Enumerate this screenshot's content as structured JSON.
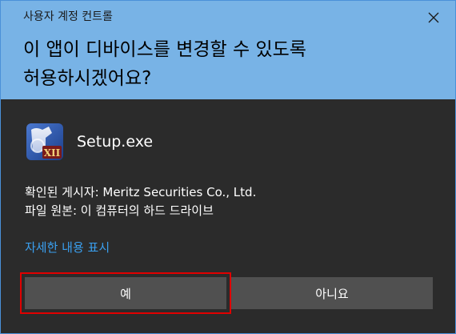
{
  "window": {
    "title": "사용자 계정 컨트롤",
    "close_icon": "close-icon"
  },
  "prompt": {
    "question": "이 앱이 디바이스를 변경할 수 있도록 허용하시겠어요?"
  },
  "app": {
    "icon": "setup-app-icon",
    "name": "Setup.exe"
  },
  "info": {
    "publisher": "확인된 게시자: Meritz Securities Co., Ltd.",
    "origin": "파일 원본: 이 컴퓨터의 하드 드라이브"
  },
  "details_link": "자세한 내용 표시",
  "buttons": {
    "yes": "예",
    "no": "아니요"
  },
  "colors": {
    "header_bg": "#78b3e6",
    "body_bg": "#2b2b2b",
    "button_bg": "#505050",
    "link": "#3aa0f0",
    "focus_border": "#e00000"
  }
}
